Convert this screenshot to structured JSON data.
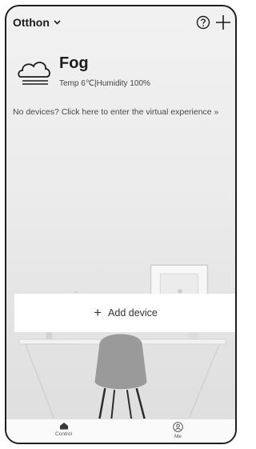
{
  "header": {
    "home_name": "Otthon",
    "icons": [
      "chevron-down-icon",
      "help-icon",
      "plus-icon"
    ]
  },
  "weather": {
    "condition": "Fog",
    "temperature": "Temp 6℃",
    "separator": "|",
    "humidity": "Humidity 100%",
    "icon": "fog-cloud-icon"
  },
  "virtual_experience": {
    "text": "No devices? Click here to enter the virtual experience »"
  },
  "add_device": {
    "icon": "plus",
    "label": "Add device"
  },
  "bottom_nav": {
    "items": [
      {
        "label": "Control",
        "icon": "home-icon"
      },
      {
        "label": "Me",
        "icon": "user-icon"
      }
    ]
  },
  "colors": {
    "background": "#ececec",
    "card": "#ffffff",
    "text": "#1c1c1c"
  }
}
